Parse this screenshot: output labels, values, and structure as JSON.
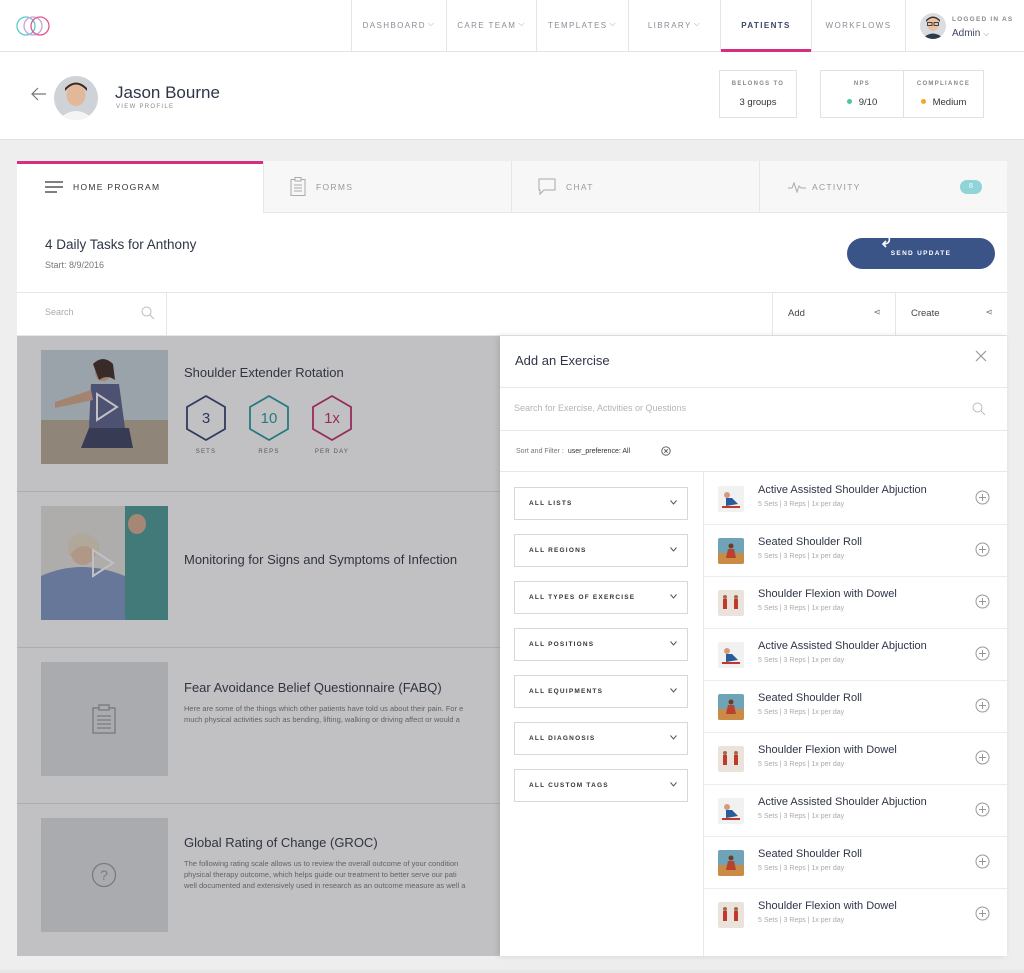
{
  "nav": {
    "items": [
      {
        "label": "DASHBOARD",
        "caret": true
      },
      {
        "label": "CARE TEAM",
        "caret": true
      },
      {
        "label": "TEMPLATES",
        "caret": true
      },
      {
        "label": "LIBRARY",
        "caret": true
      },
      {
        "label": "PATIENTS",
        "caret": false,
        "active": true
      },
      {
        "label": "WORKFLOWS",
        "caret": false
      }
    ],
    "logged_in_label": "LOGGED IN AS",
    "user_name": "Admin"
  },
  "patient": {
    "name": "Jason Bourne",
    "view_profile": "VIEW PROFILE",
    "belongs_label": "BELONGS TO",
    "belongs_value": "3 groups",
    "nps_label": "NPS",
    "nps_value": "9/10",
    "compliance_label": "COMPLIANCE",
    "compliance_value": "Medium",
    "colors": {
      "nps_dot": "#4cc3a3",
      "compliance_dot": "#f5a623"
    }
  },
  "tabs": [
    {
      "label": "HOME PROGRAM",
      "icon": "menu-lines-icon"
    },
    {
      "label": "FORMS",
      "icon": "clipboard-icon"
    },
    {
      "label": "CHAT",
      "icon": "chat-bubble-icon"
    },
    {
      "label": "ACTIVITY",
      "icon": "pulse-icon",
      "badge": "8"
    }
  ],
  "program": {
    "title": "4 Daily Tasks for Anthony",
    "start": "Start: 8/9/2016",
    "send_label": "SEND UPDATE"
  },
  "toolbar": {
    "search_placeholder": "Search",
    "add_label": "Add",
    "create_label": "Create"
  },
  "exercises": [
    {
      "title": "Shoulder Extender Rotation",
      "stats": [
        {
          "value": "3",
          "label": "SETS",
          "color": "#2f3f6e"
        },
        {
          "value": "10",
          "label": "REPS",
          "color": "#1f9aa0"
        },
        {
          "value": "1x",
          "label": "PER DAY",
          "color": "#c12a6a"
        }
      ]
    },
    {
      "title": "Monitoring for Signs and Symptoms of Infection"
    },
    {
      "title": "Fear Avoidance Belief Questionnaire (FABQ)",
      "desc": [
        "Here are some of the things which other patients have told us about their pain. For e",
        "much physical activities such as bending, lifting, walking or driving affect or would a"
      ]
    },
    {
      "title": "Global Rating of Change (GROC)",
      "desc": [
        "The following rating scale allows us to review the overall outcome of your condition",
        "physical therapy outcome, which helps guide our treatment to better serve our pati",
        "well documented and extensively used in research as an outcome measure as well a"
      ]
    }
  ],
  "panel": {
    "title": "Add an Exercise",
    "search_placeholder": "Search for Exercise, Activities or Questions",
    "sort_label": "Sort and Filter :",
    "sort_value": "user_preference: All",
    "filters": [
      "ALL LISTS",
      "ALL REGIONS",
      "ALL TYPES OF EXERCISE",
      "ALL POSITIONS",
      "ALL EQUIPMENTS",
      "ALL DIAGNOSIS",
      "ALL CUSTOM TAGS"
    ],
    "results": [
      {
        "name": "Active Assisted Shoulder Abjuction",
        "meta": "5 Sets | 3 Reps | 1x per day",
        "thumb": "a"
      },
      {
        "name": "Seated Shoulder Roll",
        "meta": "5 Sets | 3 Reps | 1x per day",
        "thumb": "b"
      },
      {
        "name": "Shoulder Flexion with Dowel",
        "meta": "5 Sets | 3 Reps | 1x per day",
        "thumb": "c"
      },
      {
        "name": "Active Assisted Shoulder Abjuction",
        "meta": "5 Sets | 3 Reps | 1x per day",
        "thumb": "a"
      },
      {
        "name": "Seated Shoulder Roll",
        "meta": "5 Sets | 3 Reps | 1x per day",
        "thumb": "b"
      },
      {
        "name": "Shoulder Flexion with Dowel",
        "meta": "5 Sets | 3 Reps | 1x per day",
        "thumb": "c"
      },
      {
        "name": "Active Assisted Shoulder Abjuction",
        "meta": "5 Sets | 3 Reps | 1x per day",
        "thumb": "a"
      },
      {
        "name": "Seated Shoulder Roll",
        "meta": "5 Sets | 3 Reps | 1x per day",
        "thumb": "b"
      },
      {
        "name": "Shoulder Flexion with Dowel",
        "meta": "5 Sets | 3 Reps | 1x per day",
        "thumb": "c"
      }
    ]
  }
}
